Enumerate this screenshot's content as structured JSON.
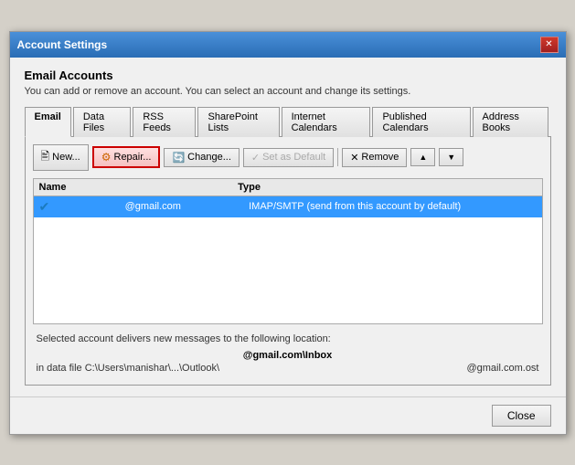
{
  "window": {
    "title": "Account Settings",
    "close_label": "✕"
  },
  "header": {
    "section_title": "Email Accounts",
    "section_desc": "You can add or remove an account. You can select an account and change its settings."
  },
  "tabs": [
    {
      "label": "Email",
      "active": true
    },
    {
      "label": "Data Files",
      "active": false
    },
    {
      "label": "RSS Feeds",
      "active": false
    },
    {
      "label": "SharePoint Lists",
      "active": false
    },
    {
      "label": "Internet Calendars",
      "active": false
    },
    {
      "label": "Published Calendars",
      "active": false
    },
    {
      "label": "Address Books",
      "active": false
    }
  ],
  "toolbar": {
    "new_label": "New...",
    "repair_label": "Repair...",
    "change_label": "Change...",
    "set_default_label": "Set as Default",
    "remove_label": "Remove"
  },
  "table": {
    "headers": {
      "name": "Name",
      "type": "Type"
    },
    "rows": [
      {
        "name": "@gmail.com",
        "type": "IMAP/SMTP (send from this account by default)"
      }
    ]
  },
  "footer": {
    "desc": "Selected account delivers new messages to the following location:",
    "path": "@gmail.com\\Inbox",
    "file_label": "in data file C:\\Users\\manishar\\...\\Outlook\\",
    "file_ext": "@gmail.com.ost"
  },
  "bottom": {
    "close_label": "Close"
  }
}
